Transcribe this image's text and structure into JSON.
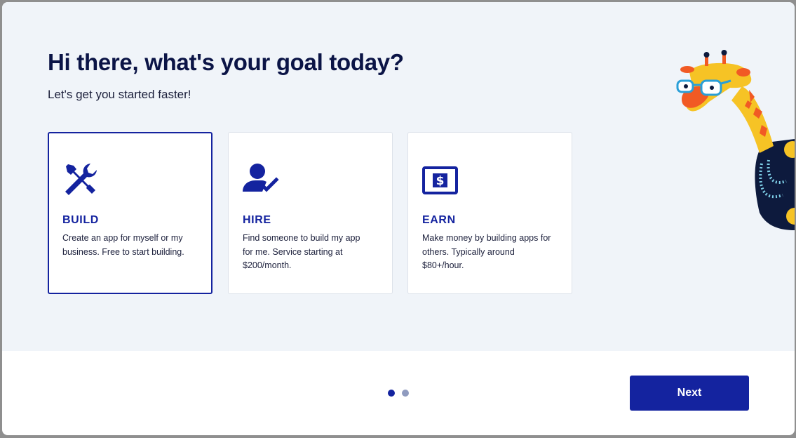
{
  "header": {
    "title": "Hi there, what's your goal today?",
    "subtitle": "Let's get you started faster!"
  },
  "cards": [
    {
      "label": "BUILD",
      "description": "Create an app for myself or my business. Free to start building.",
      "icon": "tools-icon",
      "selected": true
    },
    {
      "label": "HIRE",
      "description": "Find someone to build my app for me. Service starting at $200/month.",
      "icon": "person-check-icon",
      "selected": false
    },
    {
      "label": "EARN",
      "description": "Make money by building apps for others. Typically around $80+/hour.",
      "icon": "dollar-bill-icon",
      "selected": false
    }
  ],
  "pagination": {
    "current": 1,
    "total": 2
  },
  "footer": {
    "next_label": "Next"
  },
  "colors": {
    "accent": "#14239f",
    "title": "#0b1446",
    "panel_bg": "#f0f4f9",
    "dot_inactive": "#8f9bbf"
  }
}
